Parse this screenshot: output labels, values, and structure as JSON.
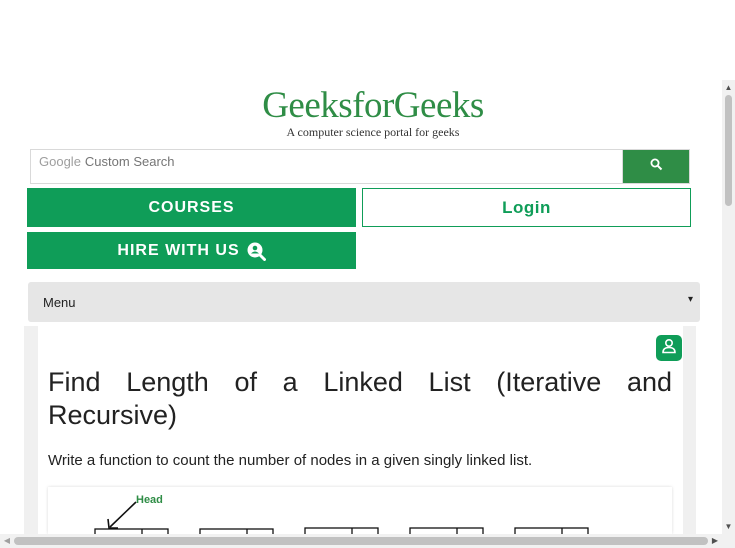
{
  "logo": {
    "wordmark": "GeeksforGeeks",
    "tagline": "A computer science portal for geeks"
  },
  "search": {
    "brand": "Google",
    "placeholder": "Custom Search",
    "button_icon": "search-icon"
  },
  "buttons": {
    "courses": "COURSES",
    "login": "Login",
    "hire": "HIRE WITH US"
  },
  "menu": {
    "label": "Menu",
    "caret": "▾"
  },
  "article": {
    "title": "Find Length of a Linked List (Iterative and Recursive)",
    "description": "Write a function to count the number of nodes in a given singly linked list.",
    "figure": {
      "head_label": "Head"
    }
  },
  "colors": {
    "brand_green": "#0f9d58",
    "logo_green": "#2f8d46",
    "menu_bg": "#e6e6e6"
  }
}
